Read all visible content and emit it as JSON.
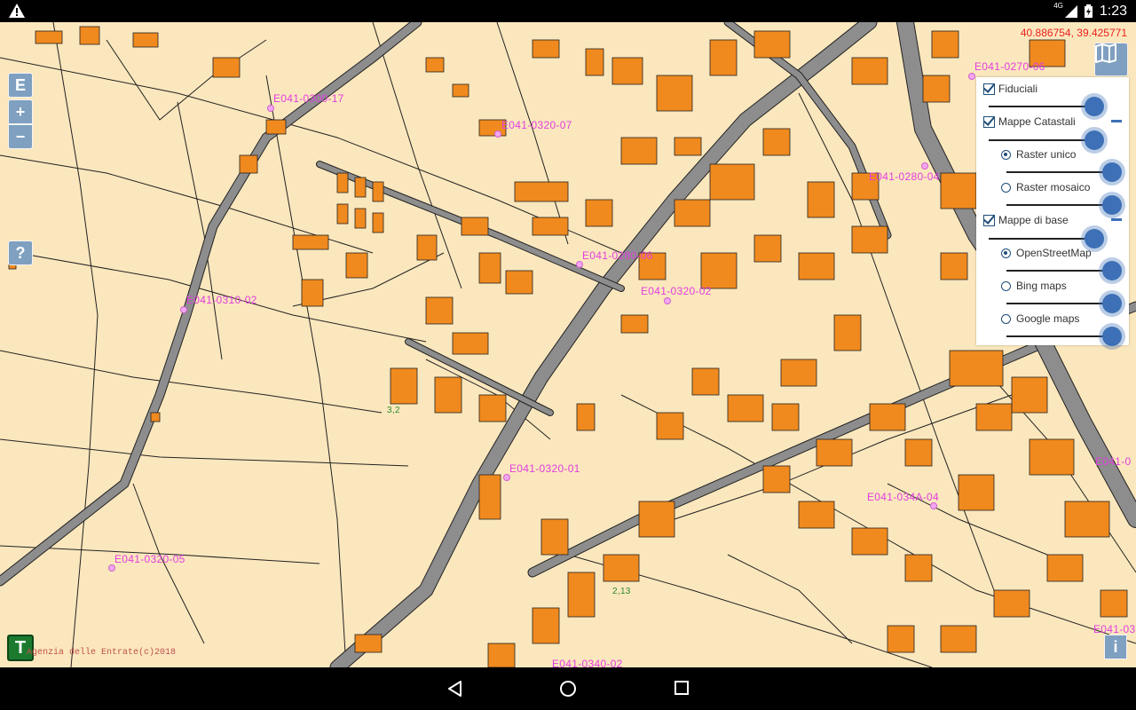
{
  "status_bar": {
    "network": "4G",
    "time": "1:23"
  },
  "map": {
    "coordinates": "40.886754, 39.425771",
    "attribution": "Agenzia delle Entrate(c)2018",
    "fiducial_labels": [
      "E041-0300-17",
      "E041-0320-07",
      "E041-0270-06",
      "E041-0280-04",
      "E041-0280-06",
      "E041-0310-02",
      "E041-0320-02",
      "E041-0320-01",
      "E041-0320-05",
      "E041-034A-04",
      "E041-0",
      "E041-03",
      "E041-0340-02"
    ],
    "minor_numbers": [
      "3,2",
      "2,13"
    ]
  },
  "controls": {
    "edit_label": "E",
    "zoom_in_label": "+",
    "zoom_out_label": "−",
    "help_label": "?",
    "tools_label": "T",
    "info_label": "i",
    "layers_icon": "map-icon"
  },
  "layer_panel": {
    "groups": [
      {
        "label": "Fiduciali",
        "checked": true,
        "opacity": 1.0
      },
      {
        "label": "Mappe Catastali",
        "checked": true,
        "opacity": 1.0,
        "options": [
          {
            "label": "Raster unico",
            "selected": true,
            "opacity": 1.0
          },
          {
            "label": "Raster mosaico",
            "selected": false,
            "opacity": 1.0
          }
        ]
      },
      {
        "label": "Mappe di base",
        "checked": true,
        "opacity": 1.0,
        "options": [
          {
            "label": "OpenStreetMap",
            "selected": true,
            "opacity": 1.0
          },
          {
            "label": "Bing maps",
            "selected": false,
            "opacity": 1.0
          },
          {
            "label": "Google maps",
            "selected": false,
            "opacity": 1.0
          }
        ]
      }
    ]
  },
  "colors": {
    "parcel_fill": "#fbe7bd",
    "building_fill": "#f08a1e",
    "road_fill": "#8d8d8d",
    "label_color": "#e23ee0",
    "button_fill": "#7fa0c0",
    "accent": "#3d70b6"
  }
}
